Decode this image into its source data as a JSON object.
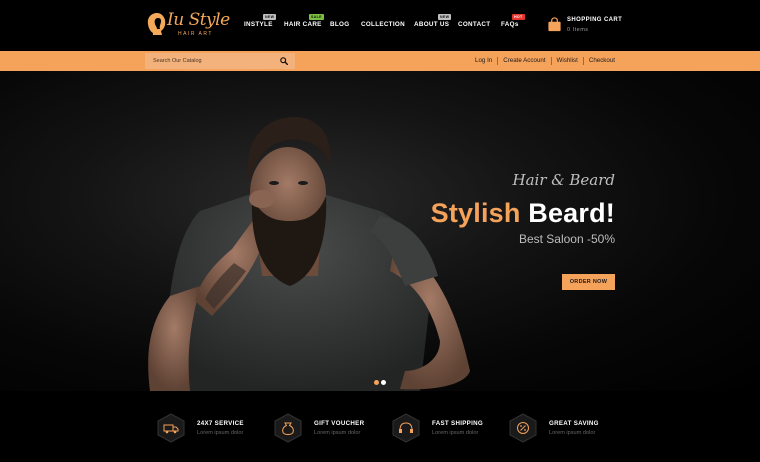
{
  "logo": {
    "script": "Iu Style",
    "sub": "HAIR ART"
  },
  "nav": [
    {
      "label": "INSTYLE",
      "badge": "NEW",
      "badge_type": "new"
    },
    {
      "label": "HAIR CARE",
      "badge": "SALE",
      "badge_type": "sale"
    },
    {
      "label": "BLOG",
      "badge": "",
      "badge_type": ""
    },
    {
      "label": "COLLECTION",
      "badge": "",
      "badge_type": ""
    },
    {
      "label": "ABOUT US",
      "badge": "NEW",
      "badge_type": "new"
    },
    {
      "label": "CONTACT",
      "badge": "",
      "badge_type": ""
    },
    {
      "label": "FAQs",
      "badge": "HOT",
      "badge_type": "hot"
    }
  ],
  "cart": {
    "title": "SHOPPING CART",
    "items": "0 Items",
    "icon": "shopping-bag-icon"
  },
  "search": {
    "placeholder": "Search Our Catalog",
    "value": "",
    "icon": "search-icon"
  },
  "account_links": [
    "Log In",
    "Create Account",
    "Wishlist",
    "Checkout"
  ],
  "hero": {
    "script": "Hair & Beard",
    "title_accent": "Stylish",
    "title_rest": "Beard!",
    "subtitle": "Best Saloon -50%",
    "button": "ORDER NOW",
    "slides": 2,
    "active_slide": 1
  },
  "features": [
    {
      "title": "24X7 SERVICE",
      "subtitle": "Lorem ipsum dolor",
      "icon": "delivery-truck-icon"
    },
    {
      "title": "GIFT VOUCHER",
      "subtitle": "Lorem ipsum dolor",
      "icon": "money-bag-icon"
    },
    {
      "title": "FAST SHIPPING",
      "subtitle": "Lorem ipsum dolor",
      "icon": "headset-icon"
    },
    {
      "title": "GREAT SAVING",
      "subtitle": "Lorem ipsum dolor",
      "icon": "discount-icon"
    }
  ],
  "colors": {
    "accent": "#f5a25b",
    "background": "#000000",
    "badge_new": "#bfbfbf",
    "badge_sale": "#7cc043",
    "badge_hot": "#e5352d"
  }
}
